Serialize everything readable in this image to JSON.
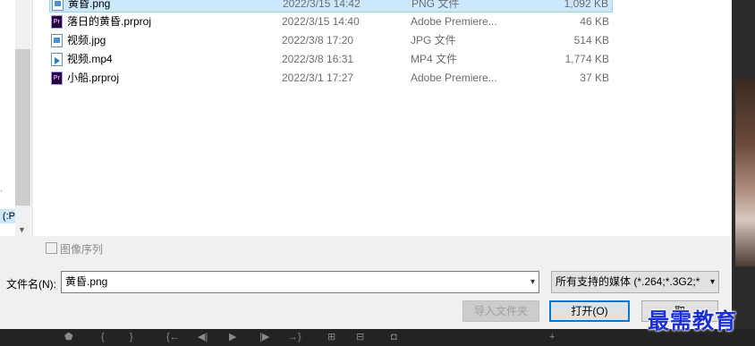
{
  "nav": {
    "partial_label": "P:)"
  },
  "files": [
    {
      "name": "黄昏.png",
      "date": "2022/3/15 14:42",
      "type": "PNG 文件",
      "size": "1,092 KB",
      "icon": "image-file-icon",
      "selected": true
    },
    {
      "name": "落日的黄昏.prproj",
      "date": "2022/3/15 14:40",
      "type": "Adobe Premiere...",
      "size": "46 KB",
      "icon": "premiere-project-icon",
      "selected": false
    },
    {
      "name": "视频.jpg",
      "date": "2022/3/8 17:20",
      "type": "JPG 文件",
      "size": "514 KB",
      "icon": "image-file-icon",
      "selected": false
    },
    {
      "name": "视频.mp4",
      "date": "2022/3/8 16:31",
      "type": "MP4 文件",
      "size": "1,774 KB",
      "icon": "video-file-icon",
      "selected": false
    },
    {
      "name": "小船.prproj",
      "date": "2022/3/1 17:27",
      "type": "Adobe Premiere...",
      "size": "37 KB",
      "icon": "premiere-project-icon",
      "selected": false
    }
  ],
  "image_sequence": {
    "label": "图像序列",
    "checked": false
  },
  "filename": {
    "label": "文件名(N):",
    "value": "黄昏.png"
  },
  "filter": {
    "value": "所有支持的媒体 (*.264;*.3G2;*"
  },
  "buttons": {
    "import_folder": "导入文件夹",
    "open": "打开(O)",
    "cancel_partial": "取"
  },
  "watermark": "最需教育",
  "colors": {
    "selection": "#cce8ff",
    "accent": "#0078d7",
    "watermark": "#1a2fd6"
  }
}
